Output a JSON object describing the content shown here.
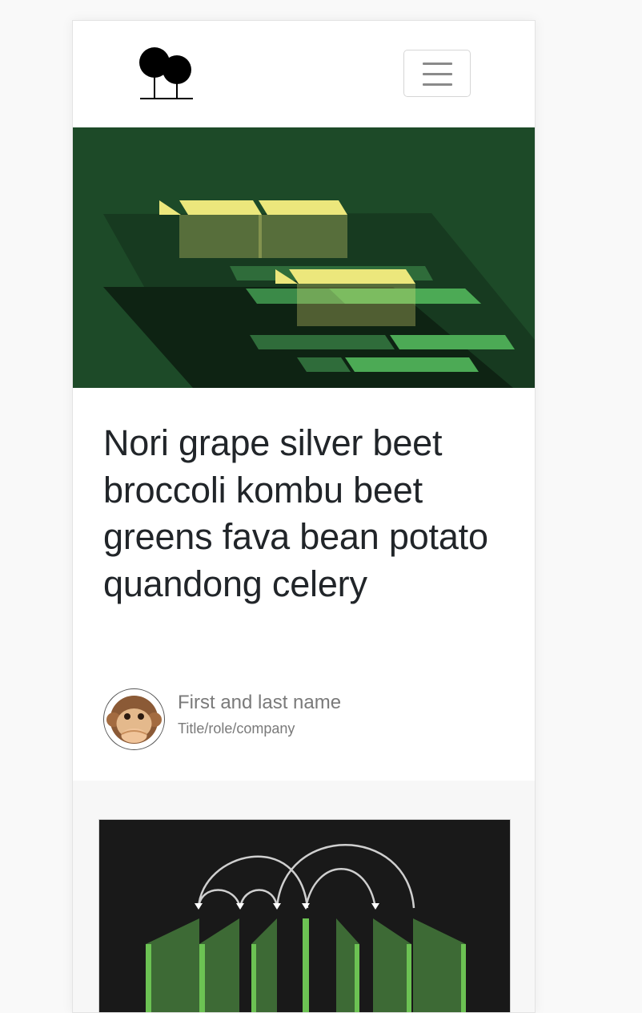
{
  "header": {
    "logo_icon": "two-trees-logo-icon",
    "menu_icon": "hamburger-menu-icon"
  },
  "hero": {
    "image_description_icon": "green-gantt-illustration"
  },
  "article": {
    "title": "Nori grape silver beet broccoli kombu beet greens fava bean potato quandong celery",
    "author": {
      "name": "First and last name",
      "role": "Title/role/company",
      "avatar_icon": "monkey-emoji-avatar"
    }
  },
  "next_card": {
    "image_icon": "green-bars-arrows-illustration"
  },
  "colors": {
    "hero_bg": "#1c4827",
    "accent_yellow": "#ece77c",
    "accent_green": "#4caa55",
    "card_bg": "#171717"
  }
}
